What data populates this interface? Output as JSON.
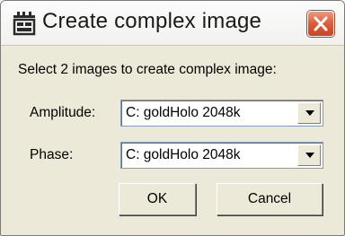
{
  "window": {
    "title": "Create complex image",
    "app_icon": "imagej-app-icon",
    "close_icon": "close-icon"
  },
  "dialog": {
    "prompt": "Select 2 images to create complex image:",
    "amplitude": {
      "label": "Amplitude:",
      "value": "C: goldHolo  2048k"
    },
    "phase": {
      "label": "Phase:",
      "value": "C: goldHolo  2048k"
    },
    "ok_label": "OK",
    "cancel_label": "Cancel"
  },
  "colors": {
    "dialog_bg": "#ece9d8",
    "close_button": "#dc5b3a"
  }
}
